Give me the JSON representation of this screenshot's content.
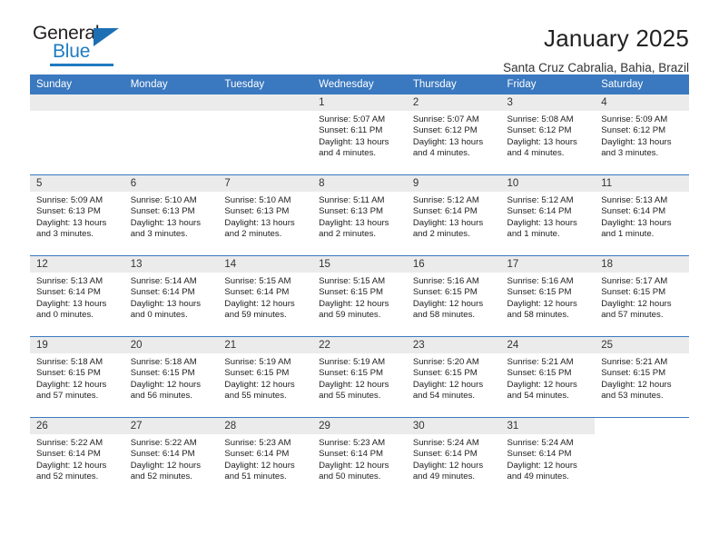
{
  "brand": {
    "name_top": "General",
    "name_bottom": "Blue",
    "accent_color": "#1f7bc1"
  },
  "header": {
    "title": "January 2025",
    "subtitle": "Santa Cruz Cabralia, Bahia, Brazil"
  },
  "calendar": {
    "header_bg": "#3a78bf",
    "daynum_bg": "#ebebeb",
    "weekday_headers": [
      "Sunday",
      "Monday",
      "Tuesday",
      "Wednesday",
      "Thursday",
      "Friday",
      "Saturday"
    ],
    "weeks": [
      [
        {
          "day": "",
          "lines": []
        },
        {
          "day": "",
          "lines": []
        },
        {
          "day": "",
          "lines": []
        },
        {
          "day": "1",
          "lines": [
            "Sunrise: 5:07 AM",
            "Sunset: 6:11 PM",
            "Daylight: 13 hours",
            "and 4 minutes."
          ]
        },
        {
          "day": "2",
          "lines": [
            "Sunrise: 5:07 AM",
            "Sunset: 6:12 PM",
            "Daylight: 13 hours",
            "and 4 minutes."
          ]
        },
        {
          "day": "3",
          "lines": [
            "Sunrise: 5:08 AM",
            "Sunset: 6:12 PM",
            "Daylight: 13 hours",
            "and 4 minutes."
          ]
        },
        {
          "day": "4",
          "lines": [
            "Sunrise: 5:09 AM",
            "Sunset: 6:12 PM",
            "Daylight: 13 hours",
            "and 3 minutes."
          ]
        }
      ],
      [
        {
          "day": "5",
          "lines": [
            "Sunrise: 5:09 AM",
            "Sunset: 6:13 PM",
            "Daylight: 13 hours",
            "and 3 minutes."
          ]
        },
        {
          "day": "6",
          "lines": [
            "Sunrise: 5:10 AM",
            "Sunset: 6:13 PM",
            "Daylight: 13 hours",
            "and 3 minutes."
          ]
        },
        {
          "day": "7",
          "lines": [
            "Sunrise: 5:10 AM",
            "Sunset: 6:13 PM",
            "Daylight: 13 hours",
            "and 2 minutes."
          ]
        },
        {
          "day": "8",
          "lines": [
            "Sunrise: 5:11 AM",
            "Sunset: 6:13 PM",
            "Daylight: 13 hours",
            "and 2 minutes."
          ]
        },
        {
          "day": "9",
          "lines": [
            "Sunrise: 5:12 AM",
            "Sunset: 6:14 PM",
            "Daylight: 13 hours",
            "and 2 minutes."
          ]
        },
        {
          "day": "10",
          "lines": [
            "Sunrise: 5:12 AM",
            "Sunset: 6:14 PM",
            "Daylight: 13 hours",
            "and 1 minute."
          ]
        },
        {
          "day": "11",
          "lines": [
            "Sunrise: 5:13 AM",
            "Sunset: 6:14 PM",
            "Daylight: 13 hours",
            "and 1 minute."
          ]
        }
      ],
      [
        {
          "day": "12",
          "lines": [
            "Sunrise: 5:13 AM",
            "Sunset: 6:14 PM",
            "Daylight: 13 hours",
            "and 0 minutes."
          ]
        },
        {
          "day": "13",
          "lines": [
            "Sunrise: 5:14 AM",
            "Sunset: 6:14 PM",
            "Daylight: 13 hours",
            "and 0 minutes."
          ]
        },
        {
          "day": "14",
          "lines": [
            "Sunrise: 5:15 AM",
            "Sunset: 6:14 PM",
            "Daylight: 12 hours",
            "and 59 minutes."
          ]
        },
        {
          "day": "15",
          "lines": [
            "Sunrise: 5:15 AM",
            "Sunset: 6:15 PM",
            "Daylight: 12 hours",
            "and 59 minutes."
          ]
        },
        {
          "day": "16",
          "lines": [
            "Sunrise: 5:16 AM",
            "Sunset: 6:15 PM",
            "Daylight: 12 hours",
            "and 58 minutes."
          ]
        },
        {
          "day": "17",
          "lines": [
            "Sunrise: 5:16 AM",
            "Sunset: 6:15 PM",
            "Daylight: 12 hours",
            "and 58 minutes."
          ]
        },
        {
          "day": "18",
          "lines": [
            "Sunrise: 5:17 AM",
            "Sunset: 6:15 PM",
            "Daylight: 12 hours",
            "and 57 minutes."
          ]
        }
      ],
      [
        {
          "day": "19",
          "lines": [
            "Sunrise: 5:18 AM",
            "Sunset: 6:15 PM",
            "Daylight: 12 hours",
            "and 57 minutes."
          ]
        },
        {
          "day": "20",
          "lines": [
            "Sunrise: 5:18 AM",
            "Sunset: 6:15 PM",
            "Daylight: 12 hours",
            "and 56 minutes."
          ]
        },
        {
          "day": "21",
          "lines": [
            "Sunrise: 5:19 AM",
            "Sunset: 6:15 PM",
            "Daylight: 12 hours",
            "and 55 minutes."
          ]
        },
        {
          "day": "22",
          "lines": [
            "Sunrise: 5:19 AM",
            "Sunset: 6:15 PM",
            "Daylight: 12 hours",
            "and 55 minutes."
          ]
        },
        {
          "day": "23",
          "lines": [
            "Sunrise: 5:20 AM",
            "Sunset: 6:15 PM",
            "Daylight: 12 hours",
            "and 54 minutes."
          ]
        },
        {
          "day": "24",
          "lines": [
            "Sunrise: 5:21 AM",
            "Sunset: 6:15 PM",
            "Daylight: 12 hours",
            "and 54 minutes."
          ]
        },
        {
          "day": "25",
          "lines": [
            "Sunrise: 5:21 AM",
            "Sunset: 6:15 PM",
            "Daylight: 12 hours",
            "and 53 minutes."
          ]
        }
      ],
      [
        {
          "day": "26",
          "lines": [
            "Sunrise: 5:22 AM",
            "Sunset: 6:14 PM",
            "Daylight: 12 hours",
            "and 52 minutes."
          ]
        },
        {
          "day": "27",
          "lines": [
            "Sunrise: 5:22 AM",
            "Sunset: 6:14 PM",
            "Daylight: 12 hours",
            "and 52 minutes."
          ]
        },
        {
          "day": "28",
          "lines": [
            "Sunrise: 5:23 AM",
            "Sunset: 6:14 PM",
            "Daylight: 12 hours",
            "and 51 minutes."
          ]
        },
        {
          "day": "29",
          "lines": [
            "Sunrise: 5:23 AM",
            "Sunset: 6:14 PM",
            "Daylight: 12 hours",
            "and 50 minutes."
          ]
        },
        {
          "day": "30",
          "lines": [
            "Sunrise: 5:24 AM",
            "Sunset: 6:14 PM",
            "Daylight: 12 hours",
            "and 49 minutes."
          ]
        },
        {
          "day": "31",
          "lines": [
            "Sunrise: 5:24 AM",
            "Sunset: 6:14 PM",
            "Daylight: 12 hours",
            "and 49 minutes."
          ]
        },
        {
          "day": "",
          "lines": []
        }
      ]
    ]
  }
}
